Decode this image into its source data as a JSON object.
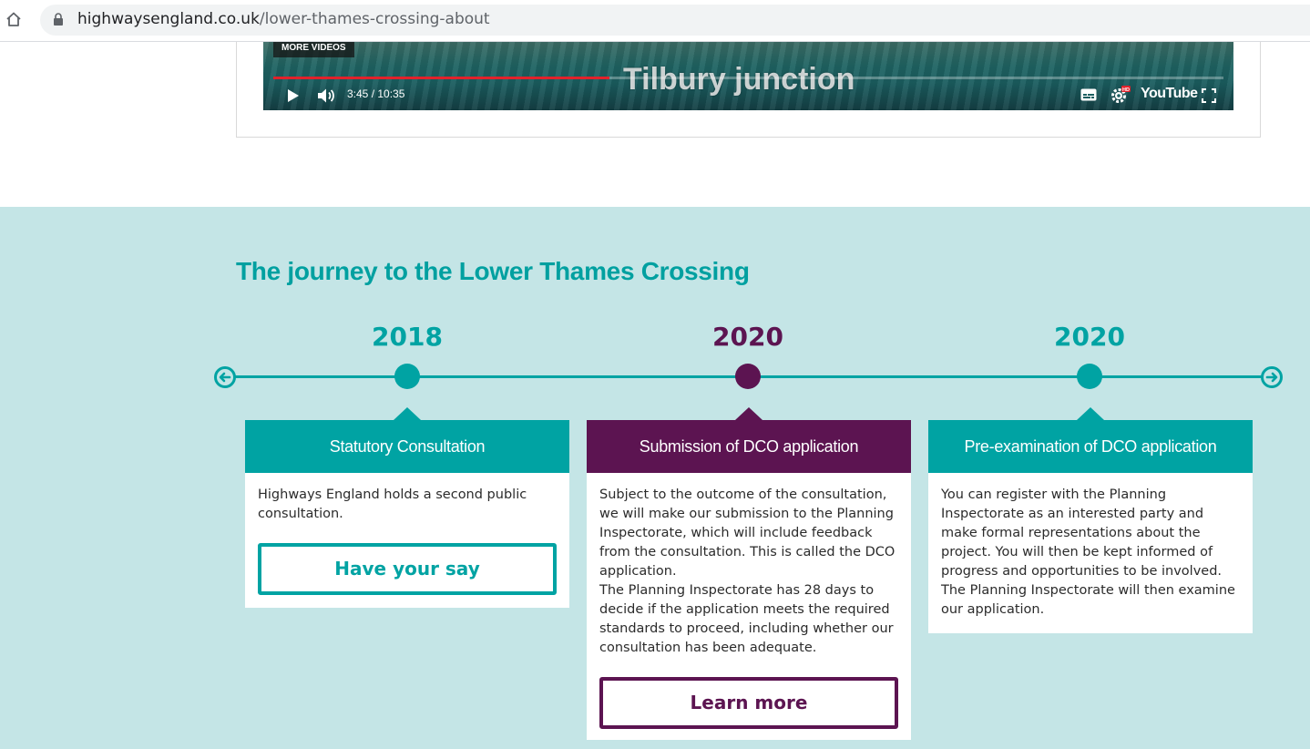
{
  "browser": {
    "url_domain": "highwaysengland.co.uk",
    "url_path": "/lower-thames-crossing-about"
  },
  "video": {
    "more_videos_label": "MORE VIDEOS",
    "caption": "Tilbury junction",
    "current_time": "3:45",
    "duration": "10:35",
    "time_display": "3:45 / 10:35",
    "progress_fraction": 0.354,
    "brand": "YouTube",
    "settings_badge": "HD"
  },
  "timeline": {
    "title": "The journey to the Lower Thames Crossing",
    "colors": {
      "teal": "#00a3a3",
      "purple": "#5c1451",
      "section_bg": "#c4e5e6"
    },
    "items": [
      {
        "year": "2018",
        "color": "#00a3a3",
        "heading": "Statutory Consultation",
        "paragraphs": [
          "Highways England holds a second public consultation."
        ],
        "button": "Have your say",
        "active": false
      },
      {
        "year": "2020",
        "color": "#5c1451",
        "heading": "Submission of DCO application",
        "paragraphs": [
          "Subject to the outcome of the consultation, we will make our submission to the Planning Inspectorate, which will include feedback from the consultation. This is called the DCO application.",
          "The Planning Inspectorate has 28 days to decide if the application meets the required standards to proceed, including whether our consultation has been adequate."
        ],
        "button": "Learn more",
        "active": true
      },
      {
        "year": "2020",
        "color": "#00a3a3",
        "heading": "Pre-examination of DCO application",
        "paragraphs": [
          "You can register with the Planning Inspectorate as an interested party and make formal representations about the project. You will then be kept informed of progress and opportunities to be involved. The Planning Inspectorate will then examine our application."
        ],
        "button": "",
        "active": false
      }
    ]
  }
}
